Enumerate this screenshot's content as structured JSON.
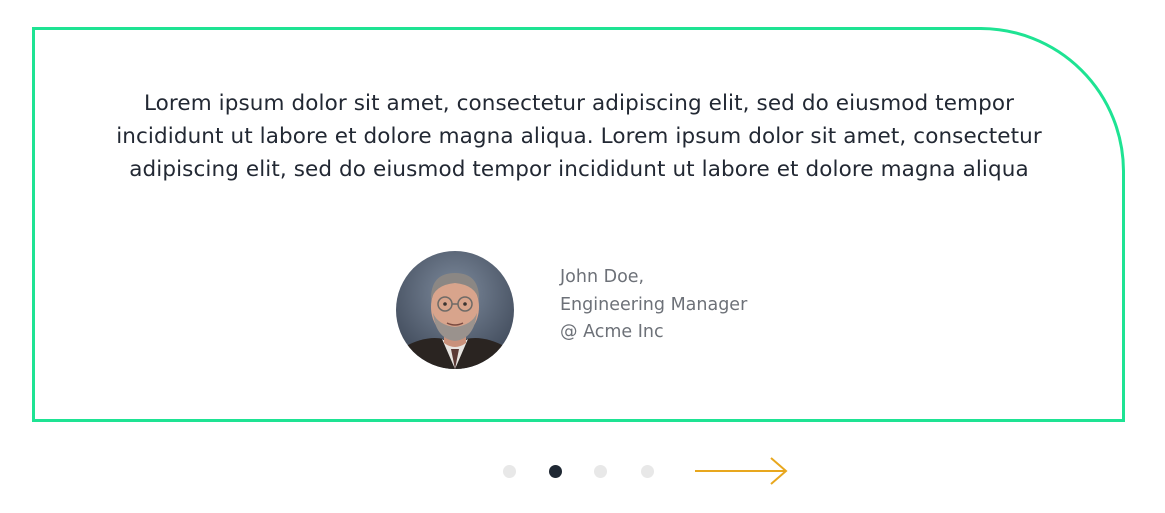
{
  "testimonial": {
    "quote": "Lorem ipsum dolor sit amet, consectetur adipiscing elit, sed do eiusmod tempor incididunt ut labore et dolore magna aliqua. Lorem ipsum dolor sit amet, consectetur adipiscing elit, sed do eiusmod tempor incididunt ut labore et dolore magna aliqua",
    "author": {
      "name": "John Doe,",
      "role": "Engineering Manager",
      "company": "@ Acme Inc"
    }
  },
  "pagination": {
    "count": 4,
    "active_index": 1,
    "next_icon": "arrow-right-icon"
  },
  "colors": {
    "border": "#1ee393",
    "arrow": "#e8a71e",
    "active_dot": "#1f2833",
    "inactive_dot": "#e8e8e8"
  }
}
